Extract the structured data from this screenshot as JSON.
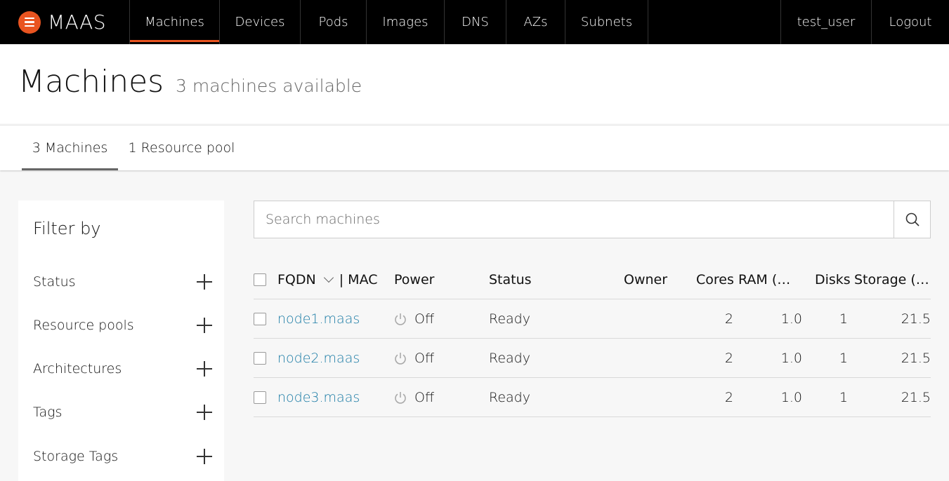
{
  "nav": {
    "brand": "MAAS",
    "items": [
      {
        "label": "Machines"
      },
      {
        "label": "Devices"
      },
      {
        "label": "Pods"
      },
      {
        "label": "Images"
      },
      {
        "label": "DNS"
      },
      {
        "label": "AZs"
      },
      {
        "label": "Subnets"
      }
    ],
    "active_item": "Machines",
    "user": "test_user",
    "logout": "Logout"
  },
  "header": {
    "title": "Machines",
    "subtitle": "3 machines available"
  },
  "tabs": [
    {
      "label": "3 Machines",
      "active": true
    },
    {
      "label": "1 Resource pool",
      "active": false
    }
  ],
  "filter": {
    "title": "Filter by",
    "items": [
      {
        "label": "Status"
      },
      {
        "label": "Resource pools"
      },
      {
        "label": "Architectures"
      },
      {
        "label": "Tags"
      },
      {
        "label": "Storage Tags"
      }
    ]
  },
  "search": {
    "placeholder": "Search machines",
    "icon": "search-icon"
  },
  "table": {
    "columns": {
      "fqdn": "FQDN",
      "mac": "| MAC",
      "power": "Power",
      "status": "Status",
      "owner": "Owner",
      "cores": "Cores",
      "ram": "RAM (…",
      "disks": "Disks",
      "storage": "Storage (…"
    },
    "rows": [
      {
        "fqdn": "node1.maas",
        "power": "Off",
        "status": "Ready",
        "owner": "",
        "cores": "2",
        "ram": "1.0",
        "disks": "1",
        "storage": "21.5"
      },
      {
        "fqdn": "node2.maas",
        "power": "Off",
        "status": "Ready",
        "owner": "",
        "cores": "2",
        "ram": "1.0",
        "disks": "1",
        "storage": "21.5"
      },
      {
        "fqdn": "node3.maas",
        "power": "Off",
        "status": "Ready",
        "owner": "",
        "cores": "2",
        "ram": "1.0",
        "disks": "1",
        "storage": "21.5"
      }
    ]
  },
  "colors": {
    "accent": "#e95420",
    "link": "#1a7ba5",
    "nav_bg": "#000000"
  }
}
